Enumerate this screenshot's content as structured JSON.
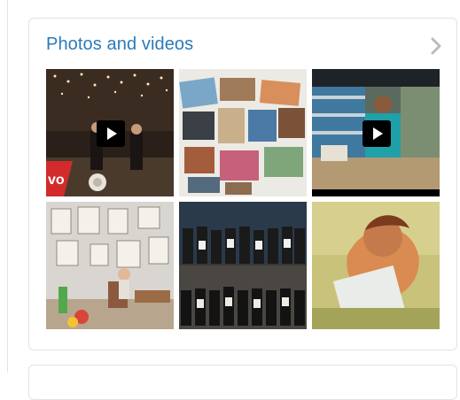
{
  "widget": {
    "title": "Photos and videos",
    "more_icon": "chevron-right-icon"
  },
  "media": [
    {
      "kind": "video",
      "subject": "performance-stage"
    },
    {
      "kind": "photo",
      "subject": "photo-cards"
    },
    {
      "kind": "video",
      "subject": "store-aisle"
    },
    {
      "kind": "photo",
      "subject": "gallery-room"
    },
    {
      "kind": "photo",
      "subject": "group-photos"
    },
    {
      "kind": "photo",
      "subject": "illustration"
    }
  ],
  "colors": {
    "title": "#2b7bb9",
    "border": "#dfe3e8",
    "chevron": "#b8bcc2"
  }
}
